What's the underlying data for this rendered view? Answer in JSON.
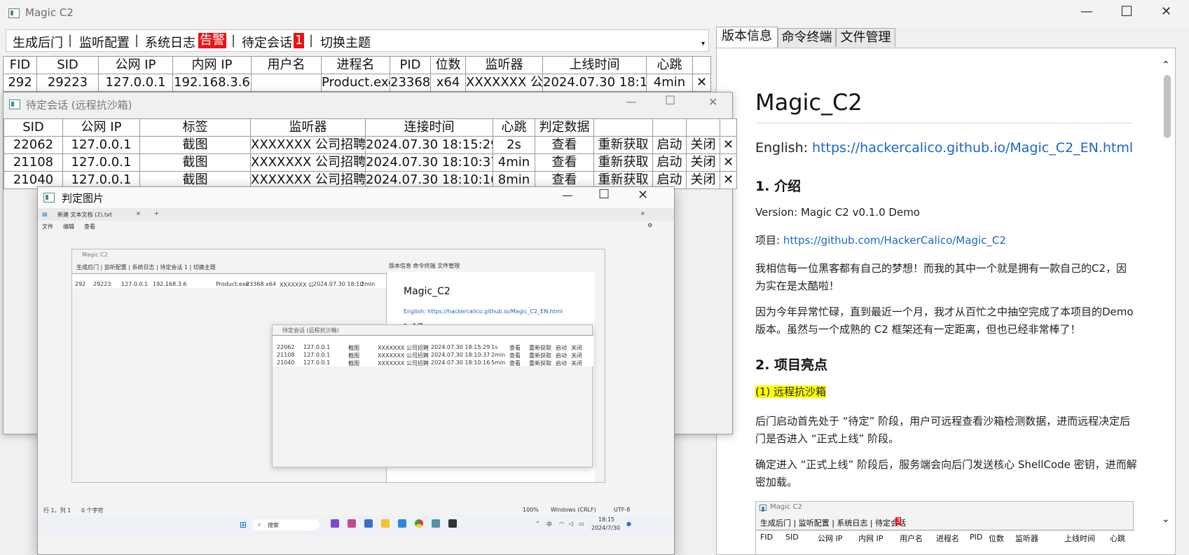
{
  "main": {
    "title": "Magic C2",
    "menu": [
      "生成后门",
      "监听配置",
      "系统日志",
      "待定会话",
      "切换主题"
    ],
    "alert_badge": "告警",
    "pending_badge": "1",
    "table_headers": [
      "FID",
      "SID",
      "公网 IP",
      "内网 IP",
      "用户名",
      "进程名",
      "PID",
      "位数",
      "监听器",
      "上线时间",
      "心跳"
    ],
    "rows": [
      [
        "292",
        "29223",
        "127.0.0.1",
        "192.168.3.6",
        "",
        "Product.exe",
        "23368",
        "x64",
        "XXXXXXX 公",
        "2024.07.30 18:10",
        "4min"
      ]
    ],
    "close_glyph": "✕"
  },
  "right_tabs": [
    "版本信息",
    "命令终端",
    "文件管理"
  ],
  "doc": {
    "title": "Magic_C2",
    "english_label": "English: ",
    "english_link": "https://hackercalico.github.io/Magic_C2_EN.html",
    "h_intro": "1. 介绍",
    "version": "Version: Magic C2 v0.1.0 Demo",
    "project_label": "项目: ",
    "project_link": "https://github.com/HackerCalico/Magic_C2",
    "p1": "我相信每一位黑客都有自己的梦想！而我的其中一个就是拥有一款自己的C2，因为实在是太酷啦！",
    "p2": "因为今年异常忙碌，直到最近一个月，我才从百忙之中抽空完成了本项目的Demo 版本。虽然与一个成熟的 C2 框架还有一定距离，但也已经非常棒了！",
    "h_highlights": "2. 项目亮点",
    "h_sandbox": "(1) 远程抗沙箱",
    "p3": "后门启动首先处于 “待定” 阶段，用户可远程查看沙箱检测数据，进而远程决定后门是否进入 “正式上线” 阶段。",
    "p4": "确定进入 “正式上线” 阶段后，服务端会向后门发送核心 ShellCode 密钥，进而解密加载。"
  },
  "doc_embedded": {
    "title": "Magic C2",
    "menu": "生成后门 | 监听配置 | 系统日志 | 待定会话",
    "badge": "3",
    "headers": [
      "FID",
      "SID",
      "公网 IP",
      "内网 IP",
      "用户名",
      "进程名",
      "PID",
      "位数",
      "监听器",
      "上线时间",
      "心跳"
    ]
  },
  "pending": {
    "title": "待定会话 (远程抗沙箱)",
    "headers": [
      "SID",
      "公网 IP",
      "标签",
      "监听器",
      "连接时间",
      "心跳",
      "判定数据"
    ],
    "rows": [
      [
        "22062",
        "127.0.0.1",
        "截图",
        "XXXXXXX 公司招聘",
        "2024.07.30 18:15:29",
        "2s",
        "查看",
        "重新获取",
        "启动",
        "关闭"
      ],
      [
        "21108",
        "127.0.0.1",
        "截图",
        "XXXXXXX 公司招聘",
        "2024.07.30 18:10:37",
        "4min",
        "查看",
        "重新获取",
        "启动",
        "关闭"
      ],
      [
        "21040",
        "127.0.0.1",
        "截图",
        "XXXXXXX 公司招聘",
        "2024.07.30 18:10:16",
        "8min",
        "查看",
        "重新获取",
        "启动",
        "关闭"
      ]
    ]
  },
  "judge": {
    "title": "判定图片",
    "notepad_tab": "新建 文本文档 (2).txt",
    "notepad_menu": [
      "文件",
      "编辑",
      "查看"
    ],
    "status_left": "行 1，列 1",
    "status_chars": "0 个字符",
    "status_zoom": "100%",
    "status_eol": "Windows (CRLF)",
    "status_enc": "UTF-8",
    "search": "搜索",
    "tray_ime": "中",
    "clock_time": "18:15",
    "clock_date": "2024/7/30",
    "inner_title": "Magic C2",
    "inner_menu": "生成后门 | 监听配置 | 系统日志 | 待定会话 1 | 切换主题",
    "inner_row": [
      "292",
      "29223",
      "127.0.0.1",
      "192.168.3.6",
      "",
      "Product.exe",
      "23368",
      "x64",
      "XXXXXXX 公",
      "2024.07.30 18:10",
      "2min"
    ],
    "inner_tabs": "版本信息  命令终端  文件管理",
    "inner_doc_title": "Magic_C2",
    "inner_english": "English: https://hackercalico.github.io/Magic_C2_EN.html",
    "inner_intro": "1. 介绍",
    "inner_pending_title": "待定会话 (远程抗沙箱)",
    "inner_pending_rows": [
      [
        "22062",
        "127.0.0.1",
        "截图",
        "XXXXXXX 公司招聘",
        "2024.07.30 18:15:29",
        "1s",
        "查看",
        "重新获取",
        "启动",
        "关闭"
      ],
      [
        "21108",
        "127.0.0.1",
        "截图",
        "XXXXXXX 公司招聘",
        "2024.07.30 18:10:37",
        "2min",
        "查看",
        "重新获取",
        "启动",
        "关闭"
      ],
      [
        "21040",
        "127.0.0.1",
        "截图",
        "XXXXXXX 公司招聘",
        "2024.07.30 18:10:16",
        "5min",
        "查看",
        "重新获取",
        "启动",
        "关闭"
      ]
    ]
  }
}
